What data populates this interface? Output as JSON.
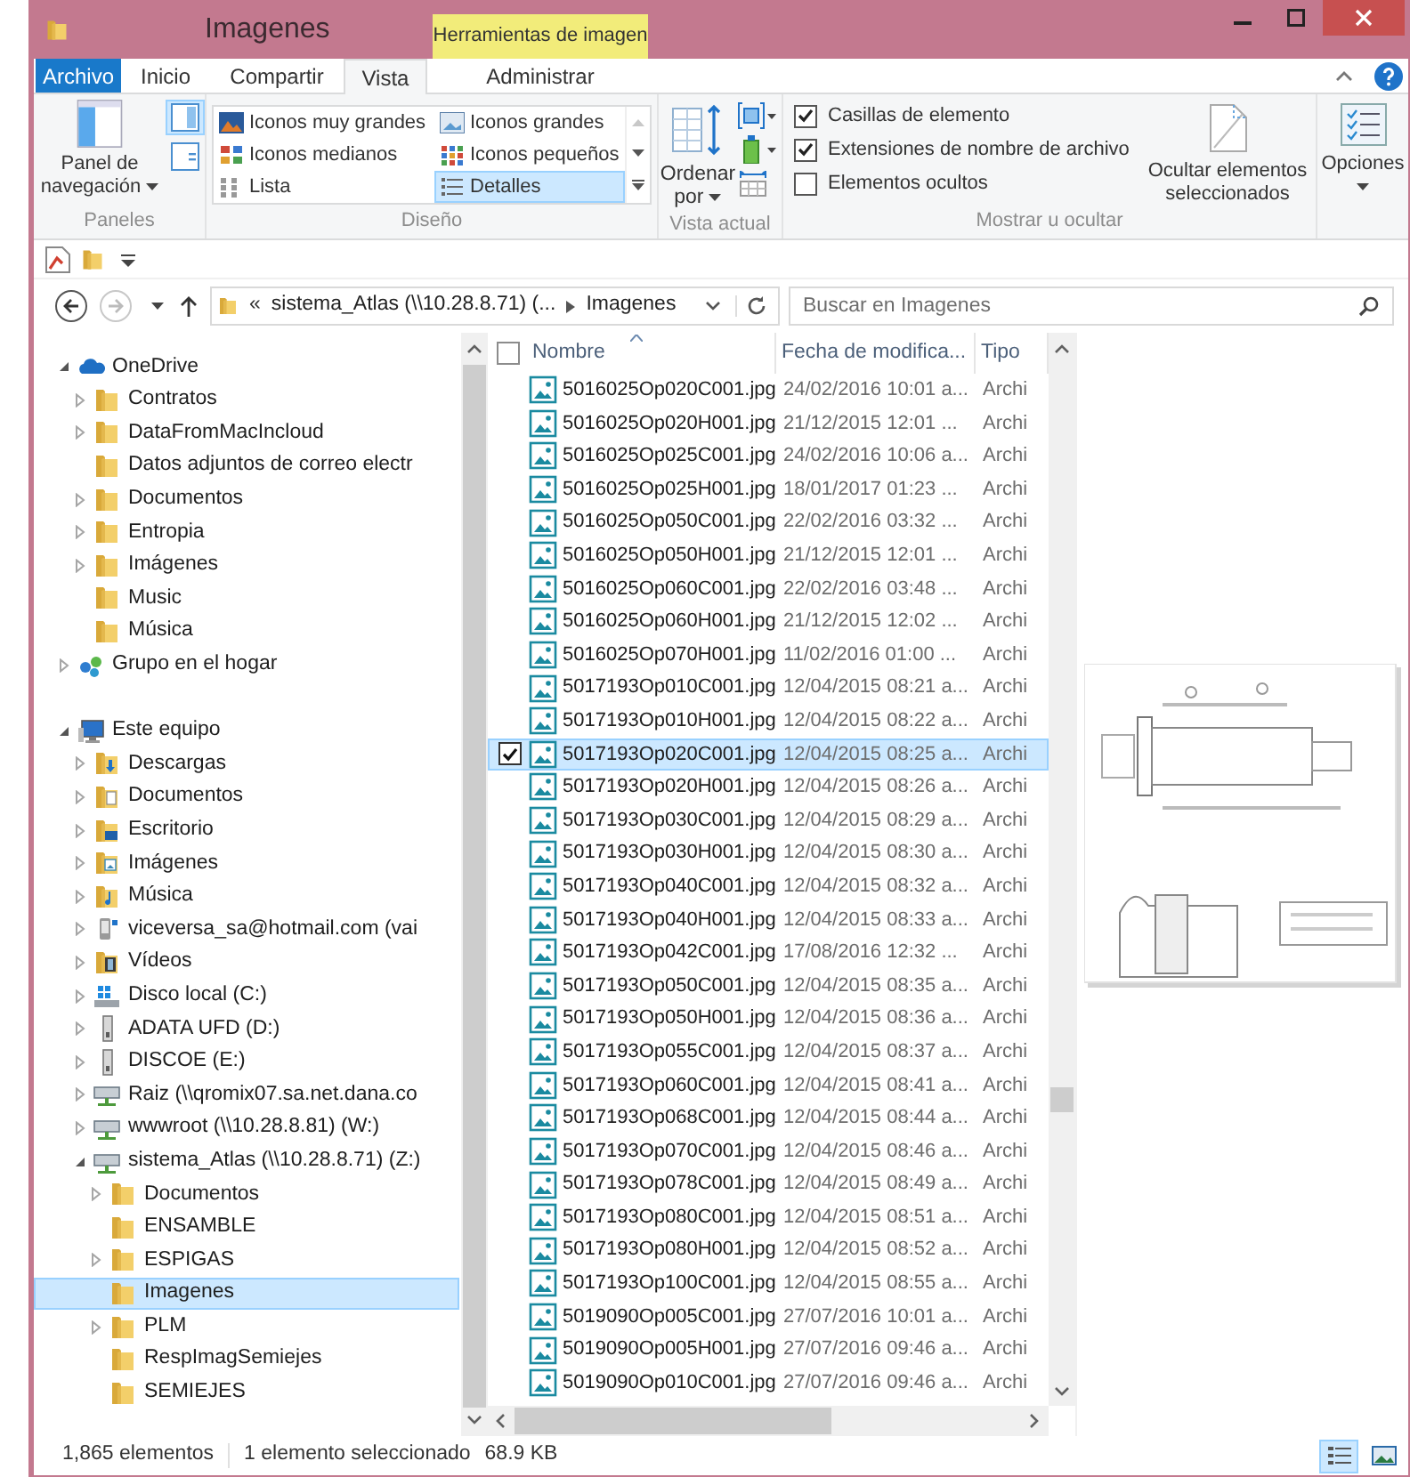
{
  "window": {
    "title": "Imagenes",
    "context_group": "Herramientas de imagen"
  },
  "ribbon_tabs": [
    {
      "label": "Archivo",
      "kind": "file",
      "selected": false
    },
    {
      "label": "Inicio",
      "kind": "tab",
      "selected": false
    },
    {
      "label": "Compartir",
      "kind": "tab",
      "selected": false
    },
    {
      "label": "Vista",
      "kind": "tab",
      "selected": true
    },
    {
      "label": "Administrar",
      "kind": "context",
      "selected": false
    }
  ],
  "ribbon": {
    "panes_group": {
      "label": "Paneles",
      "nav_pane_button": "Panel de navegación",
      "panes": [
        {
          "kind": "preview",
          "selected": true
        },
        {
          "kind": "details",
          "selected": false
        }
      ]
    },
    "layout_group": {
      "label": "Diseño",
      "layouts": [
        {
          "label": "Iconos muy grandes",
          "kind": "xl",
          "selected": false
        },
        {
          "label": "Iconos grandes",
          "kind": "large",
          "selected": false
        },
        {
          "label": "Iconos medianos",
          "kind": "medium",
          "selected": false
        },
        {
          "label": "Iconos pequeños",
          "kind": "small",
          "selected": false
        },
        {
          "label": "Lista",
          "kind": "list",
          "selected": false
        },
        {
          "label": "Detalles",
          "kind": "details",
          "selected": true
        }
      ]
    },
    "current_view_group": {
      "label": "Vista actual",
      "sort_button": "Ordenar por"
    },
    "show_hide_group": {
      "label": "Mostrar u ocultar",
      "options": [
        {
          "label": "Casillas de elemento",
          "checked": true
        },
        {
          "label": "Extensiones de nombre de archivo",
          "checked": true
        },
        {
          "label": "Elementos ocultos",
          "checked": false
        }
      ],
      "hide_button": "Ocultar elementos seleccionados"
    },
    "options_group": {
      "button": "Opciones"
    }
  },
  "address_bar": {
    "overflow": "«",
    "path": [
      "sistema_Atlas (\\\\10.28.8.71) (...",
      "Imagenes"
    ]
  },
  "search": {
    "placeholder": "Buscar en Imagenes"
  },
  "navigation": [
    {
      "label": "OneDrive",
      "kind": "cloud",
      "expanded": true,
      "selected": false,
      "children": [
        {
          "label": "Contratos",
          "kind": "folder",
          "expanded": false,
          "selected": false
        },
        {
          "label": "DataFromMacIncloud",
          "kind": "folder",
          "expanded": false,
          "selected": false
        },
        {
          "label": "Datos adjuntos de correo electr",
          "kind": "folder",
          "selected": false
        },
        {
          "label": "Documentos",
          "kind": "folder",
          "expanded": false,
          "selected": false
        },
        {
          "label": "Entropia",
          "kind": "folder",
          "expanded": false,
          "selected": false
        },
        {
          "label": "Imágenes",
          "kind": "folder",
          "expanded": false,
          "selected": false
        },
        {
          "label": "Music",
          "kind": "folder",
          "selected": false
        },
        {
          "label": "Música",
          "kind": "folder",
          "selected": false
        }
      ]
    },
    {
      "label": "Grupo en el hogar",
      "kind": "homegroup",
      "expanded": false,
      "selected": false
    },
    {
      "label": "Este equipo",
      "kind": "computer",
      "expanded": true,
      "selected": false,
      "children": [
        {
          "label": "Descargas",
          "kind": "downloads",
          "expanded": false,
          "selected": false
        },
        {
          "label": "Documentos",
          "kind": "documents",
          "expanded": false,
          "selected": false
        },
        {
          "label": "Escritorio",
          "kind": "desktop",
          "expanded": false,
          "selected": false
        },
        {
          "label": "Imágenes",
          "kind": "pictures",
          "expanded": false,
          "selected": false
        },
        {
          "label": "Música",
          "kind": "music",
          "expanded": false,
          "selected": false
        },
        {
          "label": "viceversa_sa@hotmail.com (vai",
          "kind": "phone",
          "expanded": false,
          "selected": false
        },
        {
          "label": "Vídeos",
          "kind": "videos",
          "expanded": false,
          "selected": false
        },
        {
          "label": "Disco local (C:)",
          "kind": "disk",
          "expanded": false,
          "selected": false
        },
        {
          "label": "ADATA UFD (D:)",
          "kind": "usb",
          "expanded": false,
          "selected": false
        },
        {
          "label": "DISCOE (E:)",
          "kind": "usb",
          "expanded": false,
          "selected": false
        },
        {
          "label": "Raiz (\\\\qromix07.sa.net.dana.co",
          "kind": "network",
          "expanded": false,
          "selected": false
        },
        {
          "label": "wwwroot (\\\\10.28.8.81) (W:)",
          "kind": "network",
          "expanded": false,
          "selected": false
        },
        {
          "label": "sistema_Atlas (\\\\10.28.8.71) (Z:)",
          "kind": "network",
          "expanded": true,
          "selected": false,
          "children": [
            {
              "label": "Documentos",
              "kind": "folder",
              "expanded": false,
              "selected": false
            },
            {
              "label": "ENSAMBLE",
              "kind": "folder",
              "selected": false
            },
            {
              "label": "ESPIGAS",
              "kind": "folder",
              "expanded": false,
              "selected": false
            },
            {
              "label": "Imagenes",
              "kind": "folder",
              "selected": true
            },
            {
              "label": "PLM",
              "kind": "folder",
              "expanded": false,
              "selected": false
            },
            {
              "label": "RespImagSemiejes",
              "kind": "folder",
              "selected": false
            },
            {
              "label": "SEMIEJES",
              "kind": "folder",
              "selected": false
            }
          ]
        }
      ]
    }
  ],
  "file_list": {
    "all_checked": false,
    "columns": [
      "Nombre",
      "Fecha de modifica...",
      "Tipo"
    ],
    "rows": [
      {
        "name": "5016025Op020C001.jpg",
        "modified": "24/02/2016 10:01 a...",
        "type": "Archi",
        "selected": false,
        "checked": false
      },
      {
        "name": "5016025Op020H001.jpg",
        "modified": "21/12/2015 12:01 ...",
        "type": "Archi",
        "selected": false,
        "checked": false
      },
      {
        "name": "5016025Op025C001.jpg",
        "modified": "24/02/2016 10:06 a...",
        "type": "Archi",
        "selected": false,
        "checked": false
      },
      {
        "name": "5016025Op025H001.jpg",
        "modified": "18/01/2017 01:23 ...",
        "type": "Archi",
        "selected": false,
        "checked": false
      },
      {
        "name": "5016025Op050C001.jpg",
        "modified": "22/02/2016 03:32 ...",
        "type": "Archi",
        "selected": false,
        "checked": false
      },
      {
        "name": "5016025Op050H001.jpg",
        "modified": "21/12/2015 12:01 ...",
        "type": "Archi",
        "selected": false,
        "checked": false
      },
      {
        "name": "5016025Op060C001.jpg",
        "modified": "22/02/2016 03:48 ...",
        "type": "Archi",
        "selected": false,
        "checked": false
      },
      {
        "name": "5016025Op060H001.jpg",
        "modified": "21/12/2015 12:02 ...",
        "type": "Archi",
        "selected": false,
        "checked": false
      },
      {
        "name": "5016025Op070H001.jpg",
        "modified": "11/02/2016 01:00 ...",
        "type": "Archi",
        "selected": false,
        "checked": false
      },
      {
        "name": "5017193Op010C001.jpg",
        "modified": "12/04/2015 08:21 a...",
        "type": "Archi",
        "selected": false,
        "checked": false
      },
      {
        "name": "5017193Op010H001.jpg",
        "modified": "12/04/2015 08:22 a...",
        "type": "Archi",
        "selected": false,
        "checked": false
      },
      {
        "name": "5017193Op020C001.jpg",
        "modified": "12/04/2015 08:25 a...",
        "type": "Archi",
        "selected": true,
        "checked": true
      },
      {
        "name": "5017193Op020H001.jpg",
        "modified": "12/04/2015 08:26 a...",
        "type": "Archi",
        "selected": false,
        "checked": false
      },
      {
        "name": "5017193Op030C001.jpg",
        "modified": "12/04/2015 08:29 a...",
        "type": "Archi",
        "selected": false,
        "checked": false
      },
      {
        "name": "5017193Op030H001.jpg",
        "modified": "12/04/2015 08:30 a...",
        "type": "Archi",
        "selected": false,
        "checked": false
      },
      {
        "name": "5017193Op040C001.jpg",
        "modified": "12/04/2015 08:32 a...",
        "type": "Archi",
        "selected": false,
        "checked": false
      },
      {
        "name": "5017193Op040H001.jpg",
        "modified": "12/04/2015 08:33 a...",
        "type": "Archi",
        "selected": false,
        "checked": false
      },
      {
        "name": "5017193Op042C001.jpg",
        "modified": "17/08/2016 12:32 ...",
        "type": "Archi",
        "selected": false,
        "checked": false
      },
      {
        "name": "5017193Op050C001.jpg",
        "modified": "12/04/2015 08:35 a...",
        "type": "Archi",
        "selected": false,
        "checked": false
      },
      {
        "name": "5017193Op050H001.jpg",
        "modified": "12/04/2015 08:36 a...",
        "type": "Archi",
        "selected": false,
        "checked": false
      },
      {
        "name": "5017193Op055C001.jpg",
        "modified": "12/04/2015 08:37 a...",
        "type": "Archi",
        "selected": false,
        "checked": false
      },
      {
        "name": "5017193Op060C001.jpg",
        "modified": "12/04/2015 08:41 a...",
        "type": "Archi",
        "selected": false,
        "checked": false
      },
      {
        "name": "5017193Op068C001.jpg",
        "modified": "12/04/2015 08:44 a...",
        "type": "Archi",
        "selected": false,
        "checked": false
      },
      {
        "name": "5017193Op070C001.jpg",
        "modified": "12/04/2015 08:46 a...",
        "type": "Archi",
        "selected": false,
        "checked": false
      },
      {
        "name": "5017193Op078C001.jpg",
        "modified": "12/04/2015 08:49 a...",
        "type": "Archi",
        "selected": false,
        "checked": false
      },
      {
        "name": "5017193Op080C001.jpg",
        "modified": "12/04/2015 08:51 a...",
        "type": "Archi",
        "selected": false,
        "checked": false
      },
      {
        "name": "5017193Op080H001.jpg",
        "modified": "12/04/2015 08:52 a...",
        "type": "Archi",
        "selected": false,
        "checked": false
      },
      {
        "name": "5017193Op100C001.jpg",
        "modified": "12/04/2015 08:55 a...",
        "type": "Archi",
        "selected": false,
        "checked": false
      },
      {
        "name": "5019090Op005C001.jpg",
        "modified": "27/07/2016 10:01 a...",
        "type": "Archi",
        "selected": false,
        "checked": false
      },
      {
        "name": "5019090Op005H001.jpg",
        "modified": "27/07/2016 09:46 a...",
        "type": "Archi",
        "selected": false,
        "checked": false
      },
      {
        "name": "5019090Op010C001.jpg",
        "modified": "27/07/2016 09:46 a...",
        "type": "Archi",
        "selected": false,
        "checked": false
      }
    ]
  },
  "status_bar": {
    "count": "1,865 elementos",
    "selection": "1 elemento seleccionado",
    "size": "68.9 KB",
    "views": [
      {
        "kind": "details",
        "selected": true
      },
      {
        "kind": "large_icons",
        "selected": false
      }
    ]
  }
}
